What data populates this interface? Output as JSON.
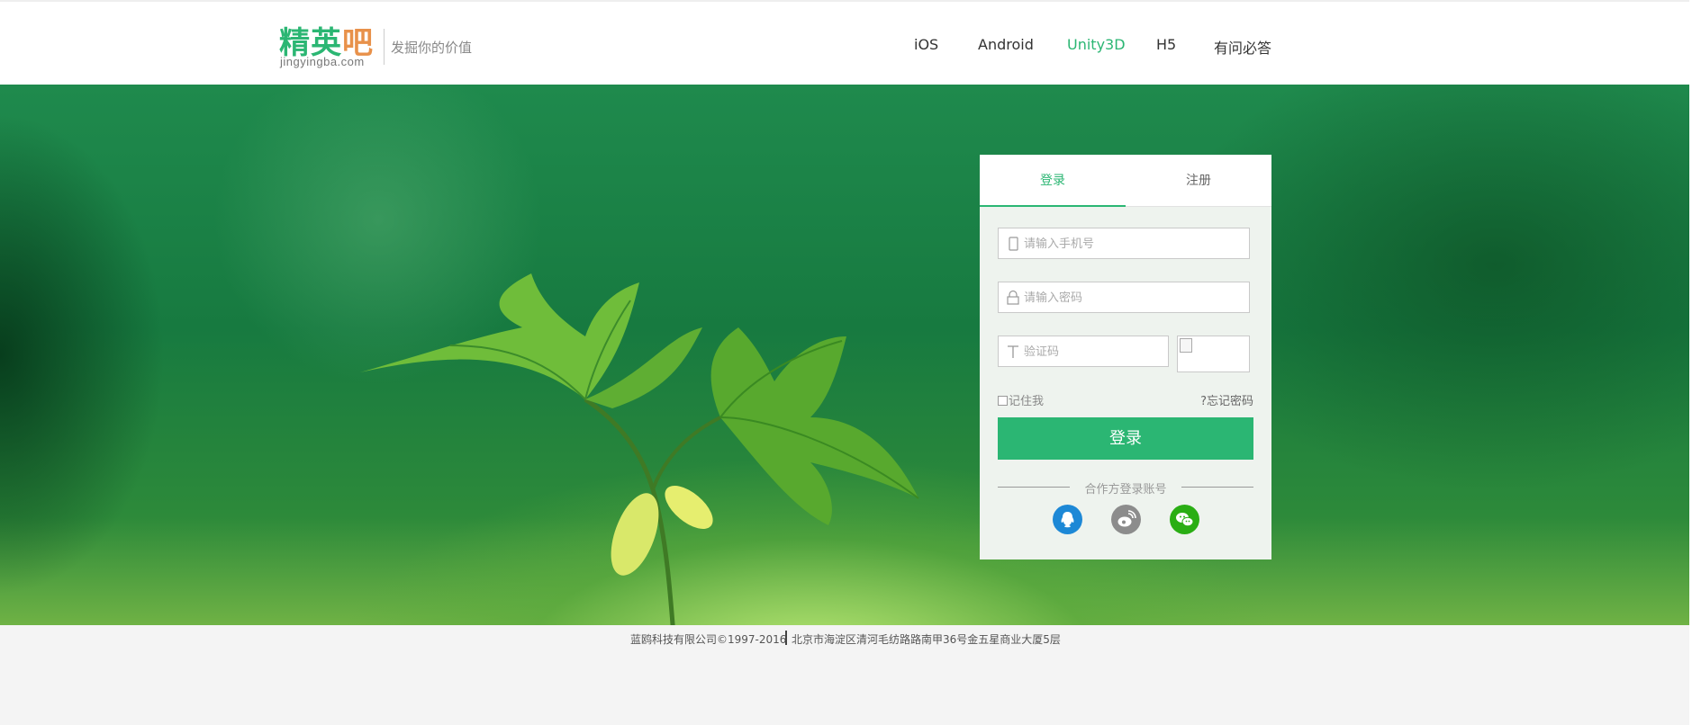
{
  "header": {
    "logo_cn_green": "精英",
    "logo_cn_orange": "吧",
    "logo_en": "jingyingba.com",
    "slogan": "发掘你的价值",
    "nav": [
      {
        "label": "iOS"
      },
      {
        "label": "Android"
      },
      {
        "label": "Unity3D",
        "active": true
      },
      {
        "label": "H5"
      },
      {
        "label": "有问必答"
      }
    ]
  },
  "login": {
    "tabs": [
      {
        "label": "登录",
        "active": true
      },
      {
        "label": "注册"
      }
    ],
    "phone_placeholder": "请输入手机号",
    "password_placeholder": "请输入密码",
    "captcha_placeholder": "验证码",
    "remember_label": "记住我",
    "forgot_label": "?忘记密码",
    "submit_label": "登录",
    "partner_label": "合作方登录账号",
    "partners": [
      {
        "icon": "qq-icon",
        "color": "#1d88d6"
      },
      {
        "icon": "weibo-icon",
        "color": "#8c8c8c"
      },
      {
        "icon": "wechat-icon",
        "color": "#2aae14"
      }
    ]
  },
  "footer": {
    "company": "蓝鸥科技有限公司©1997-2016",
    "address": "北京市海淀区清河毛纺路路南甲36号金五星商业大厦5层"
  },
  "colors": {
    "accent": "#2bb673",
    "logo_orange": "#e8914a"
  }
}
